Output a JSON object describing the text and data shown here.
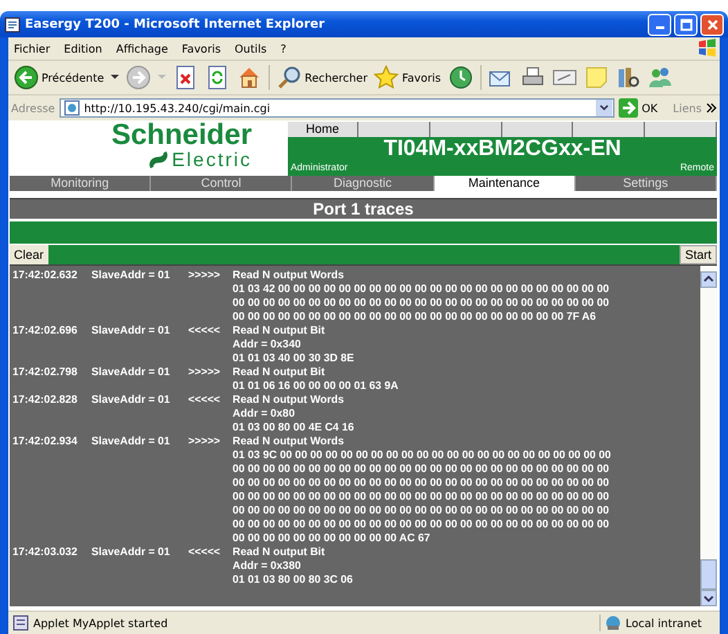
{
  "window": {
    "title": "Easergy T200 - Microsoft Internet Explorer"
  },
  "menu": [
    "Fichier",
    "Edition",
    "Affichage",
    "Favoris",
    "Outils",
    "?"
  ],
  "toolbar": {
    "back": "Précédente",
    "search": "Rechercher",
    "favorites": "Favoris"
  },
  "address": {
    "label": "Adresse",
    "url": "http://10.195.43.240/cgi/main.cgi",
    "go": "OK",
    "links": "Liens"
  },
  "header": {
    "logo_top": "Schneider",
    "logo_bottom": "Electric",
    "home_link": "Home",
    "device": "TI04M-xxBM2CGxx-EN",
    "user": "Administrator",
    "mode": "Remote"
  },
  "tabs": [
    {
      "label": "Monitoring",
      "selected": false
    },
    {
      "label": "Control",
      "selected": false
    },
    {
      "label": "Diagnostic",
      "selected": false
    },
    {
      "label": "Maintenance",
      "selected": true
    },
    {
      "label": "Settings",
      "selected": false
    }
  ],
  "section_title": "Port 1 traces",
  "buttons": {
    "clear": "Clear",
    "start": "Start"
  },
  "traces": [
    {
      "time": "17:42:02.632",
      "slave": "SlaveAddr = 01",
      "direction": ">>>>>",
      "lines": [
        "Read N output Words",
        "01 03 42 00 00 00 00 00 00 00 00 00 00 00 00 00 00 00 00 00 00 00 00 00 00",
        "00 00 00 00 00 00 00 00 00 00 00 00 00 00 00 00 00 00 00 00 00 00 00 00 00",
        "00 00 00 00 00 00 00 00 00 00 00 00 00 00 00 00 00 00 00 00 00 00 7F A6"
      ]
    },
    {
      "time": "17:42:02.696",
      "slave": "SlaveAddr = 01",
      "direction": "<<<<<",
      "lines": [
        "Read N output Bit",
        "Addr = 0x340",
        "01 01 03 40 00 30 3D 8E"
      ]
    },
    {
      "time": "17:42:02.798",
      "slave": "SlaveAddr = 01",
      "direction": ">>>>>",
      "lines": [
        "Read N output Bit",
        "01 01 06 16 00 00 00 00 01 63 9A"
      ]
    },
    {
      "time": "17:42:02.828",
      "slave": "SlaveAddr = 01",
      "direction": "<<<<<",
      "lines": [
        "Read N output Words",
        "Addr = 0x80",
        "01 03 00 80 00 4E C4 16"
      ]
    },
    {
      "time": "17:42:02.934",
      "slave": "SlaveAddr = 01",
      "direction": ">>>>>",
      "lines": [
        "Read N output Words",
        "01 03 9C 00 00 00 00 00 00 00 00 00 00 00 00 00 00 00 00 00 00 00 00 00 00",
        "00 00 00 00 00 00 00 00 00 00 00 00 00 00 00 00 00 00 00 00 00 00 00 00 00",
        "00 00 00 00 00 00 00 00 00 00 00 00 00 00 00 00 00 00 00 00 00 00 00 00 00",
        "00 00 00 00 00 00 00 00 00 00 00 00 00 00 00 00 00 00 00 00 00 00 00 00 00",
        "00 00 00 00 00 00 00 00 00 00 00 00 00 00 00 00 00 00 00 00 00 00 00 00 00",
        "00 00 00 00 00 00 00 00 00 00 00 00 00 00 00 00 00 00 00 00 00 00 00 00 00",
        "00 00 00 00 00 00 00 00 00 00 00 AC 67"
      ]
    },
    {
      "time": "17:42:03.032",
      "slave": "SlaveAddr = 01",
      "direction": "<<<<<",
      "lines": [
        "Read N output Bit",
        "Addr = 0x380",
        "01 01 03 80 00 80 3C 06"
      ]
    }
  ],
  "status_bar": {
    "text": "Applet MyApplet started",
    "zone": "Local intranet"
  }
}
